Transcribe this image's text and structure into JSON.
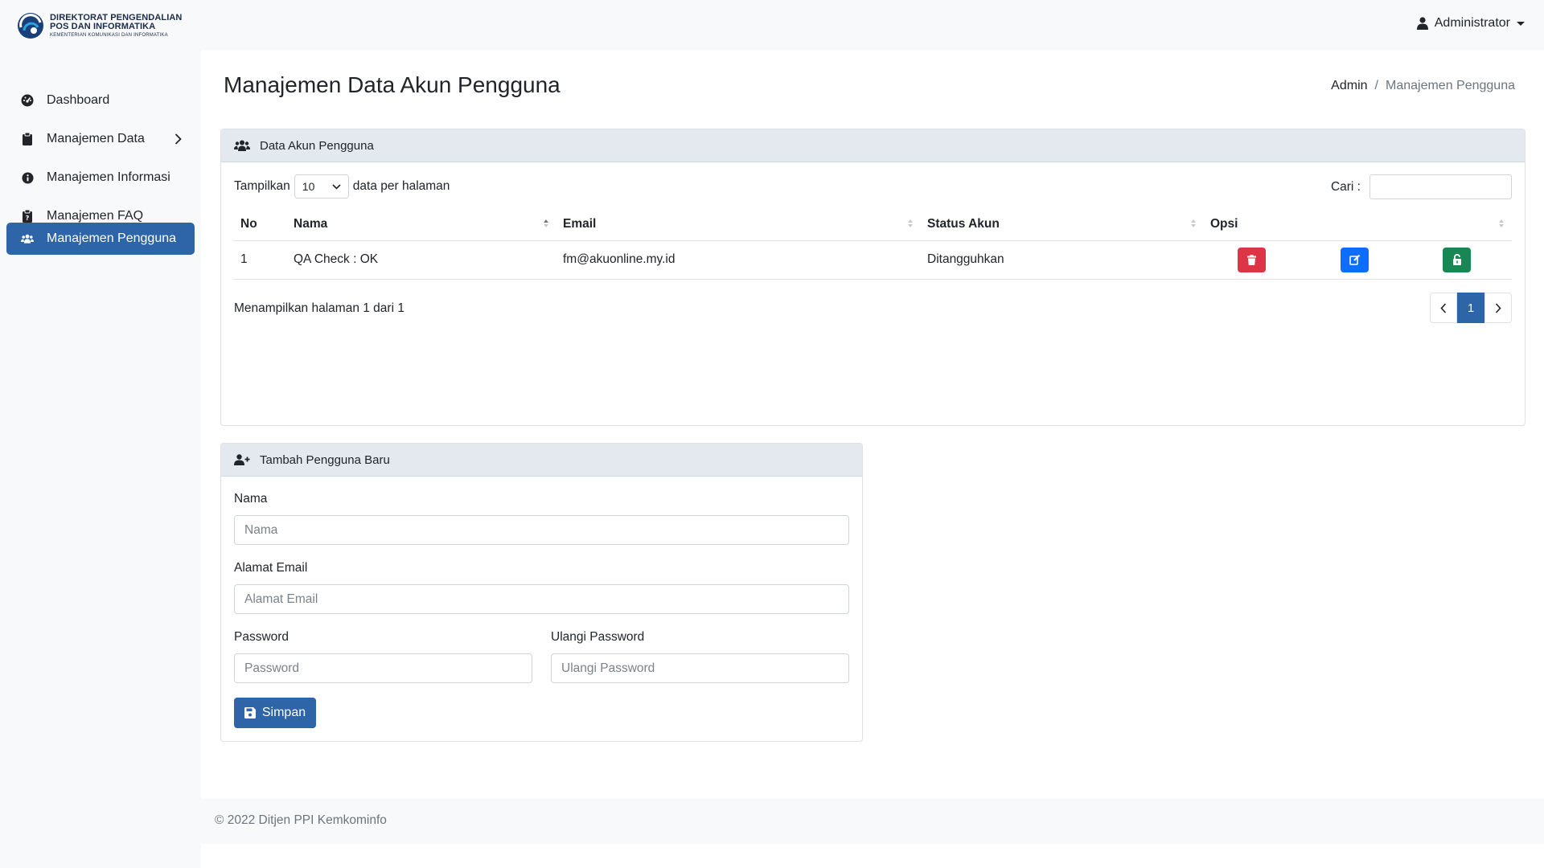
{
  "brand": {
    "line1": "DIREKTORAT PENGENDALIAN",
    "line2": "POS DAN INFORMATIKA",
    "line3": "KEMENTERIAN KOMUNIKASI DAN INFORMATIKA"
  },
  "user_menu": {
    "label": "Administrator",
    "icon": "user-icon"
  },
  "sidebar": {
    "items": [
      {
        "label": "Dashboard",
        "icon": "dashboard-icon"
      },
      {
        "label": "Manajemen Data",
        "icon": "clipboard-icon"
      },
      {
        "label": "Manajemen Informasi",
        "icon": "info-icon"
      },
      {
        "label": "Manajemen FAQ",
        "icon": "question-clipboard-icon"
      },
      {
        "label": "Manajemen Pengguna",
        "icon": "users-icon",
        "active": true
      }
    ]
  },
  "page": {
    "title": "Manajemen Data Akun Pengguna"
  },
  "breadcrumb": {
    "root": "Admin",
    "separator": "/",
    "current": "Manajemen Pengguna"
  },
  "users_card": {
    "title": "Data Akun Pengguna",
    "length_prefix": "Tampilkan",
    "length_value": "10",
    "length_suffix": "data per halaman",
    "search_label": "Cari :",
    "columns": [
      "No",
      "Nama",
      "Email",
      "Status Akun",
      "Opsi"
    ],
    "rows": [
      {
        "no": "1",
        "nama": "QA Check : OK",
        "email": "fm@akuonline.my.id",
        "status": "Ditangguhkan"
      }
    ],
    "info": "Menampilkan halaman 1 dari 1",
    "pagination": {
      "current": "1"
    }
  },
  "add_user_card": {
    "title": "Tambah Pengguna Baru",
    "name_label": "Nama",
    "name_placeholder": "Nama",
    "email_label": "Alamat Email",
    "email_placeholder": "Alamat Email",
    "password_label": "Password",
    "password_placeholder": "Password",
    "repeat_label": "Ulangi Password",
    "repeat_placeholder": "Ulangi Password",
    "save_label": "Simpan"
  },
  "footer": {
    "text": "© 2022 Ditjen PPI Kemkominfo"
  },
  "colors": {
    "primary": "#2d65a8",
    "danger": "#dc3545",
    "info": "#0d6efd",
    "success": "#198754"
  }
}
